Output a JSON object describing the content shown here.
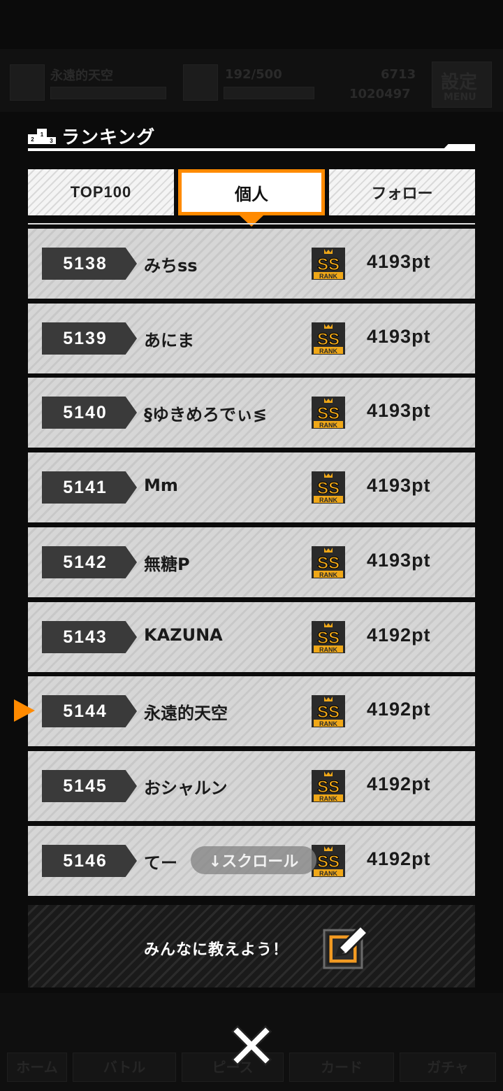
{
  "background": {
    "player_name": "永遠的天空",
    "stamina": "192/500",
    "coins": "6713",
    "points": "1020497",
    "settings_label": "設定",
    "menu_label": "MENU",
    "nav": [
      "ホーム",
      "バトル",
      "ピース",
      "カード",
      "ガチャ"
    ]
  },
  "modal": {
    "title": "ランキング",
    "tabs": [
      {
        "label": "TOP100",
        "active": false
      },
      {
        "label": "個人",
        "active": true
      },
      {
        "label": "フォロー",
        "active": false
      }
    ],
    "rows": [
      {
        "rank": "5138",
        "name": "みちss",
        "badge": "SS RANK",
        "points": "4193pt",
        "current": false
      },
      {
        "rank": "5139",
        "name": "あにま",
        "badge": "SS RANK",
        "points": "4193pt",
        "current": false
      },
      {
        "rank": "5140",
        "name": "§ゆきめろでぃ≶",
        "badge": "SS RANK",
        "points": "4193pt",
        "current": false
      },
      {
        "rank": "5141",
        "name": "Mm",
        "badge": "SS RANK",
        "points": "4193pt",
        "current": false
      },
      {
        "rank": "5142",
        "name": "無糖P",
        "badge": "SS RANK",
        "points": "4193pt",
        "current": false
      },
      {
        "rank": "5143",
        "name": "KAZUNA",
        "badge": "SS RANK",
        "points": "4192pt",
        "current": false
      },
      {
        "rank": "5144",
        "name": "永遠的天空",
        "badge": "SS RANK",
        "points": "4192pt",
        "current": true
      },
      {
        "rank": "5145",
        "name": "おシャルン",
        "badge": "SS RANK",
        "points": "4192pt",
        "current": false
      },
      {
        "rank": "5146",
        "name": "てー",
        "badge": "SS RANK",
        "points": "4192pt",
        "current": false
      }
    ],
    "scroll_hint": "↓スクロール",
    "share_text": "みんなに教えよう！",
    "share_icon": "edit-icon",
    "close_icon": "close-icon"
  },
  "colors": {
    "accent": "#ff8a00",
    "rank_badge_bg": "#3a3a3a",
    "ss_rank_gold": "#f0a818"
  }
}
